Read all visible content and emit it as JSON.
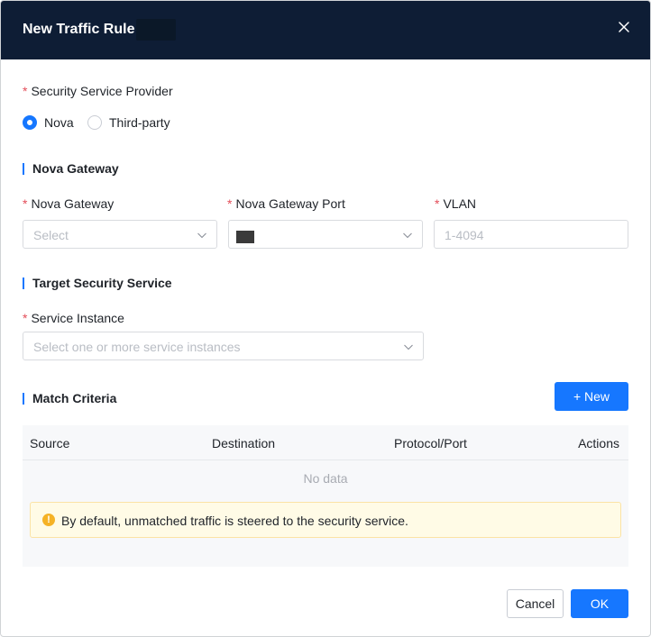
{
  "modal": {
    "title": "New Traffic Rule"
  },
  "provider": {
    "label": "Security Service Provider",
    "options": [
      {
        "label": "Nova",
        "checked": true
      },
      {
        "label": "Third-party",
        "checked": false
      }
    ]
  },
  "gateway_section": {
    "title": "Nova Gateway",
    "gateway": {
      "label": "Nova Gateway",
      "placeholder": "Select"
    },
    "port": {
      "label": "Nova Gateway Port"
    },
    "vlan": {
      "label": "VLAN",
      "placeholder": "1-4094"
    }
  },
  "target_section": {
    "title": "Target Security Service",
    "instance": {
      "label": "Service Instance",
      "placeholder": "Select one or more service instances"
    }
  },
  "match_section": {
    "title": "Match Criteria",
    "new_button": "+ New",
    "columns": [
      "Source",
      "Destination",
      "Protocol/Port",
      "Actions"
    ],
    "empty_text": "No data",
    "notice": "By default, unmatched traffic is steered to the security service."
  },
  "footer": {
    "cancel": "Cancel",
    "ok": "OK"
  },
  "colors": {
    "header_bg": "#0e1d35",
    "primary": "#1677ff",
    "required": "#e34d59",
    "warning": "#f5b226"
  },
  "icons": {
    "close": "close-icon",
    "chevron": "chevron-down-icon",
    "warning": "warning-icon"
  }
}
